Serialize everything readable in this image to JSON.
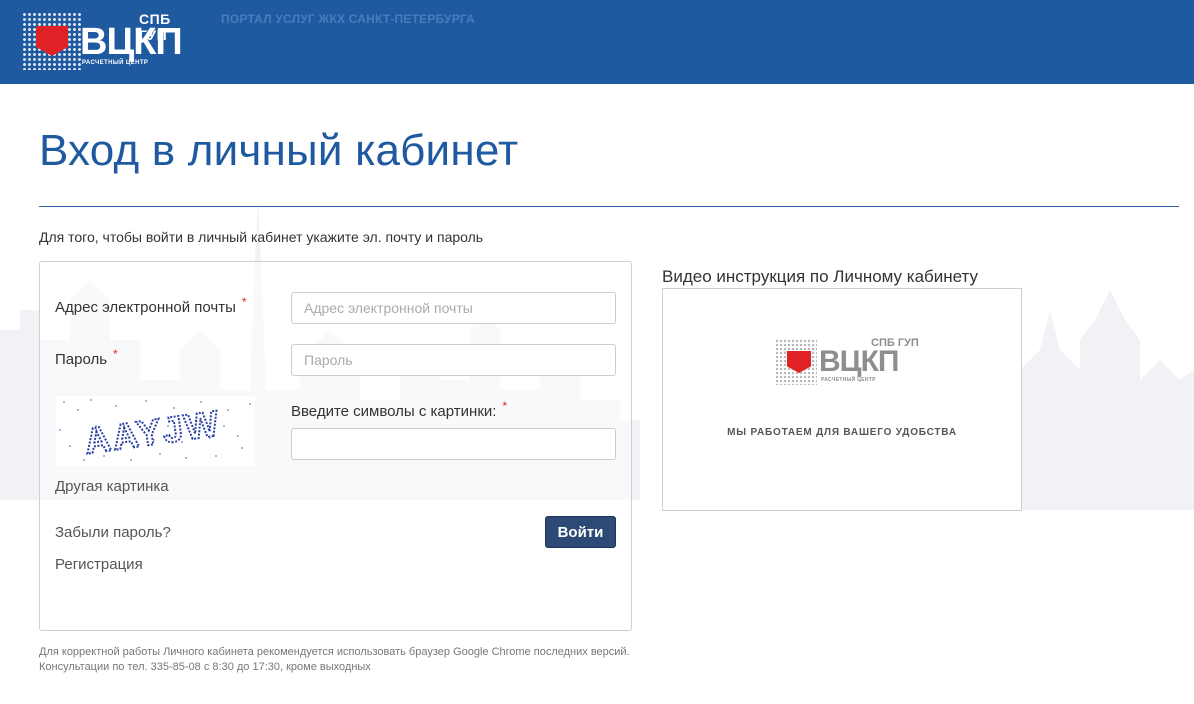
{
  "header": {
    "logo": {
      "top_text": "СПБ ГУП",
      "main_text": "ВЦКП",
      "sub_text": "РАСЧЕТНЫЙ ЦЕНТР"
    },
    "portal_title": "ПОРТАЛ УСЛУГ ЖКХ САНКТ-ПЕТЕРБУРГА",
    "background_color": "#1f5aa0"
  },
  "page": {
    "title": "Вход в личный кабинет",
    "intro": "Для того, чтобы войти в личный кабинет укажите эл. почту и пароль"
  },
  "login_form": {
    "email_label": "Адрес электронной почты",
    "email_placeholder": "Адрес электронной почты",
    "email_value": "",
    "password_label": "Пароль",
    "password_placeholder": "Пароль",
    "password_value": "",
    "captcha_text": "AAYJW",
    "captcha_label": "Введите символы с картинки:",
    "captcha_value": "",
    "required_mark": "*",
    "other_image_link": "Другая картинка",
    "forgot_password_link": "Забыли пароль?",
    "register_link": "Регистрация",
    "submit_label": "Войти",
    "submit_color": "#2c4a75"
  },
  "video": {
    "title": "Видео инструкция по Личному кабинету",
    "logo": {
      "top_text": "СПБ ГУП",
      "main_text": "ВЦКП",
      "sub_text": "РАСЧЕТНЫЙ ЦЕНТР"
    },
    "slogan": "МЫ РАБОТАЕМ ДЛЯ ВАШЕГО УДОБСТВА"
  },
  "footer": {
    "line1": "Для корректной работы Личного кабинета рекомендуется использовать браузер Google Chrome последних версий.",
    "line2": "Консультации по тел. 335-85-08 с 8:30 до 17:30, кроме выходных"
  },
  "colors": {
    "accent": "#1f5aa0",
    "required": "#e02226",
    "brand_red": "#e02226"
  }
}
